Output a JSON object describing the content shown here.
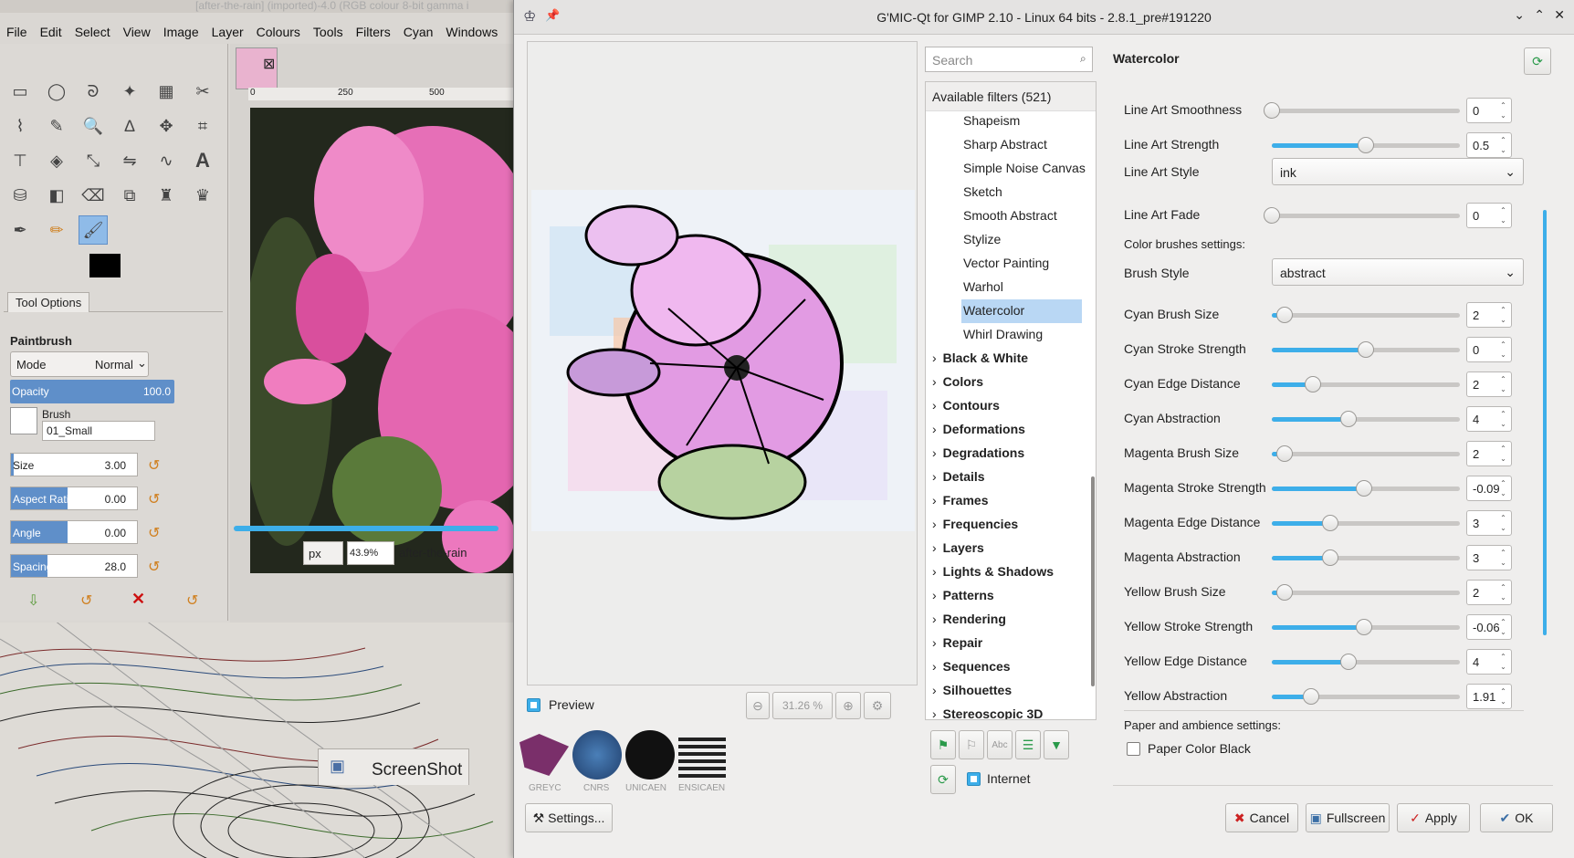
{
  "gimp": {
    "title": "[after-the-rain] (imported)-4.0 (RGB colour 8-bit gamma i",
    "menu": [
      "File",
      "Edit",
      "Select",
      "View",
      "Image",
      "Layer",
      "Colours",
      "Tools",
      "Filters",
      "Cyan",
      "Windows"
    ],
    "tool_options_tab": "Tool Options",
    "tool_name": "Paintbrush",
    "mode_label": "Mode",
    "mode_value": "Normal",
    "opacity_label": "Opacity",
    "opacity_value": "100.0",
    "brush_label": "Brush",
    "brush_value": "01_Small",
    "size_label": "Size",
    "size_value": "3.00",
    "aspect_label": "Aspect Ratio",
    "aspect_value": "0.00",
    "angle_label": "Angle",
    "angle_value": "0.00",
    "spacing_label": "Spacing",
    "spacing_value": "28.0",
    "unit": "px",
    "zoom": "43.9%",
    "status_file": "after-the-rain",
    "ruler_marks": [
      "0",
      "250",
      "500"
    ],
    "taskbar_item": "ScreenShot"
  },
  "gmic": {
    "title": "G'MIC-Qt for GIMP 2.10 - Linux 64 bits - 2.8.1_pre#191220",
    "preview_label": "Preview",
    "preview_zoom": "31.26 %",
    "settings_button": "Settings...",
    "logos": [
      "GREYC",
      "CNRS",
      "UNICAEN",
      "ENSICAEN"
    ],
    "search_placeholder": "Search",
    "available_filters": "Available filters (521)",
    "filter_items": [
      "Shapeism",
      "Sharp Abstract",
      "Simple Noise Canvas",
      "Sketch",
      "Smooth Abstract",
      "Stylize",
      "Vector Painting",
      "Warhol",
      "Watercolor",
      "Whirl Drawing"
    ],
    "selected_filter": "Watercolor",
    "categories": [
      "Black & White",
      "Colors",
      "Contours",
      "Deformations",
      "Degradations",
      "Details",
      "Frames",
      "Frequencies",
      "Layers",
      "Lights & Shadows",
      "Patterns",
      "Rendering",
      "Repair",
      "Sequences",
      "Silhouettes",
      "Stereoscopic 3D"
    ],
    "internet_label": "Internet",
    "filter_title": "Watercolor",
    "params": [
      {
        "label": "Line Art Smoothness",
        "value": "0",
        "level": 0.0
      },
      {
        "label": "Line Art Strength",
        "value": "0.5",
        "level": 0.5
      },
      {
        "label": "Line Art Fade",
        "value": "0",
        "level": 0.0
      },
      {
        "label": "Cyan Brush Size",
        "value": "2",
        "level": 0.07
      },
      {
        "label": "Cyan Stroke Strength",
        "value": "0",
        "level": 0.5
      },
      {
        "label": "Cyan Edge Distance",
        "value": "2",
        "level": 0.22
      },
      {
        "label": "Cyan Abstraction",
        "value": "4",
        "level": 0.41
      },
      {
        "label": "Magenta Brush Size",
        "value": "2",
        "level": 0.07
      },
      {
        "label": "Magenta Stroke Strength",
        "value": "-0.09",
        "level": 0.49
      },
      {
        "label": "Magenta Edge Distance",
        "value": "3",
        "level": 0.31
      },
      {
        "label": "Magenta Abstraction",
        "value": "3",
        "level": 0.31
      },
      {
        "label": "Yellow Brush Size",
        "value": "2",
        "level": 0.07
      },
      {
        "label": "Yellow Stroke Strength",
        "value": "-0.06",
        "level": 0.49
      },
      {
        "label": "Yellow Edge Distance",
        "value": "4",
        "level": 0.41
      },
      {
        "label": "Yellow Abstraction",
        "value": "1.91",
        "level": 0.21
      }
    ],
    "line_art_style_label": "Line Art Style",
    "line_art_style_value": "ink",
    "color_brushes_section": "Color brushes settings:",
    "brush_style_label": "Brush Style",
    "brush_style_value": "abstract",
    "paper_section": "Paper and ambience settings:",
    "paper_black_label": "Paper Color Black",
    "buttons": {
      "cancel": "Cancel",
      "fullscreen": "Fullscreen",
      "apply": "Apply",
      "ok": "OK"
    }
  },
  "colors": {
    "accent": "#3daee9",
    "selection": "#b9d7f4",
    "gimp_slider": "#5f8fc9"
  }
}
